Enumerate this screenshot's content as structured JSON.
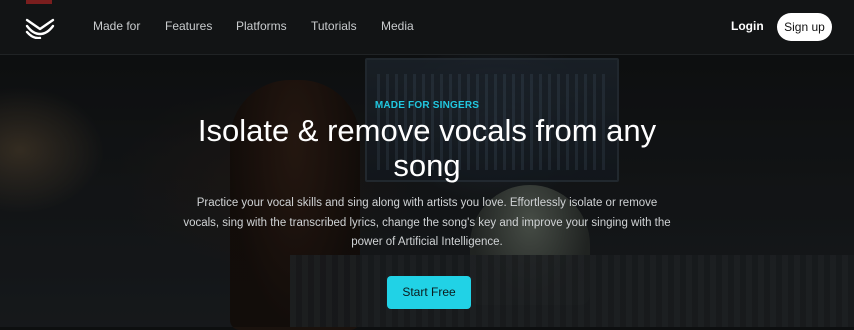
{
  "brand": {
    "logo_icon": "waves-logo-icon",
    "accent": "#21d2e6"
  },
  "nav": {
    "items": [
      {
        "label": "Made for"
      },
      {
        "label": "Features"
      },
      {
        "label": "Platforms"
      },
      {
        "label": "Tutorials"
      },
      {
        "label": "Media"
      }
    ],
    "login_label": "Login",
    "signup_label": "Sign up"
  },
  "hero": {
    "eyebrow": "MADE FOR SINGERS",
    "title": "Isolate & remove vocals from any song",
    "description": "Practice your vocal skills and sing along with artists you love. Effortlessly isolate or remove vocals, sing with the transcribed lyrics, change the song's key and improve your singing with the power of Artificial Intelligence.",
    "cta_label": "Start Free"
  }
}
